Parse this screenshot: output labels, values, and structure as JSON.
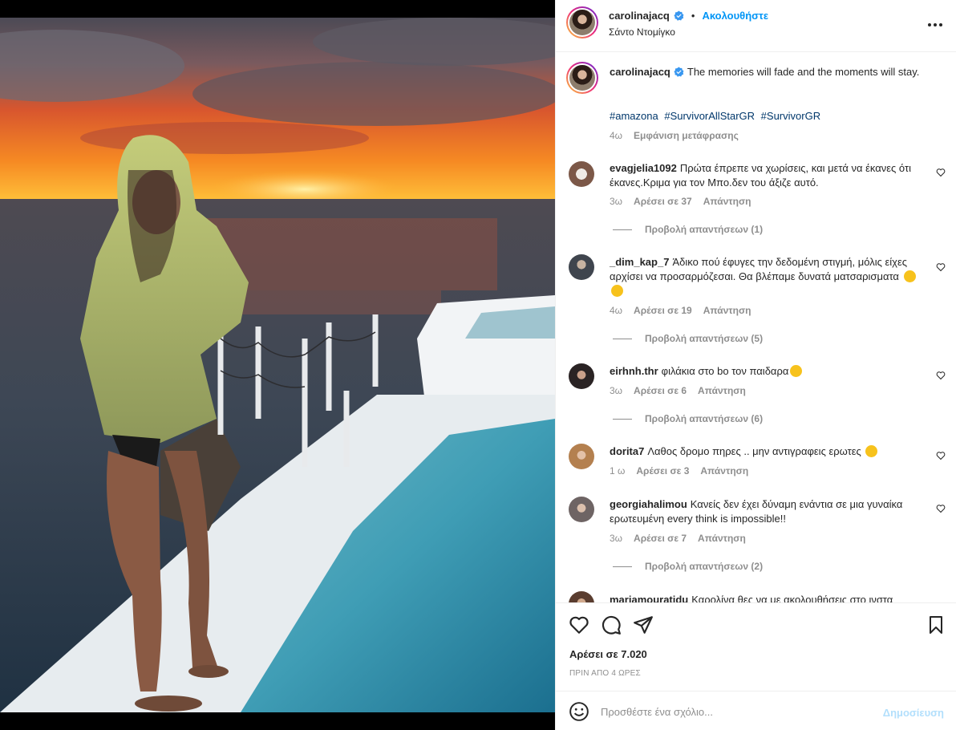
{
  "post": {
    "username": "carolinajacq",
    "verified": true,
    "follow_label": "Ακολουθήστε",
    "location": "Σάντο Ντομίγκο",
    "caption": "The memories will fade and the moments will stay.",
    "hashtags": [
      "#amazona",
      "#SurvivorAllStarGR",
      "#SurvivorGR"
    ],
    "caption_time": "4ω",
    "translate_label": "Εμφάνιση μετάφρασης"
  },
  "comments": [
    {
      "username": "evagjelia1092",
      "text": "Πρώτα έπρεπε να χωρίσεις, και μετά να έκανες ότι έκανες.Κριμα για τον Μπο.δεν του άξιζε αυτό.",
      "time": "3ω",
      "likes": "Αρέσει σε 37",
      "reply": "Απάντηση",
      "view_replies": "Προβολή απαντήσεων (1)"
    },
    {
      "username": "_dim_kap_7",
      "text": "Άδικο πού έφυγες την δεδομένη στιγμή, μόλις είχες αρχίσει να προσαρμόζεσαι. Θα βλέπαμε δυνατά ματσαρισματα",
      "time": "4ω",
      "likes": "Αρέσει σε 19",
      "reply": "Απάντηση",
      "view_replies": "Προβολή απαντήσεων (5)"
    },
    {
      "username": "eirhnh.thr",
      "text": "φιλάκια στο bo τον παιδαρα",
      "time": "3ω",
      "likes": "Αρέσει σε 6",
      "reply": "Απάντηση",
      "view_replies": "Προβολή απαντήσεων (6)"
    },
    {
      "username": "dorita7",
      "text": "Λαθος δρομο πηρες .. μην αντιγραφεις ερωτες",
      "time": "1 ω",
      "likes": "Αρέσει σε 3",
      "reply": "Απάντηση"
    },
    {
      "username": "georgiahalimou",
      "text": "Κανείς δεν έχει δύναμη ενάντια σε μια γυναίκα ερωτευμένη every think is impossible!!",
      "time": "3ω",
      "likes": "Αρέσει σε 7",
      "reply": "Απάντηση",
      "view_replies": "Προβολή απαντήσεων (2)"
    },
    {
      "username": "mariamouratidu",
      "text": "Καρολίνα θες να με ακολουθήσεις στο ινστα"
    }
  ],
  "footer": {
    "likes": "Αρέσει σε 7.020",
    "time_ago": "ΠΡΙΝ ΑΠΟ 4 ΩΡΕΣ",
    "comment_placeholder": "Προσθέστε ένα σχόλιο...",
    "post_label": "Δημοσίευση"
  },
  "colors": {
    "accent": "#0095f6",
    "hashtag": "#00376b",
    "muted": "#8e8e8e",
    "post_disabled": "#b2dffc"
  },
  "icons": [
    "heart-icon",
    "comment-icon",
    "share-icon",
    "bookmark-icon",
    "emoji-icon",
    "more-icon",
    "verified-icon"
  ]
}
